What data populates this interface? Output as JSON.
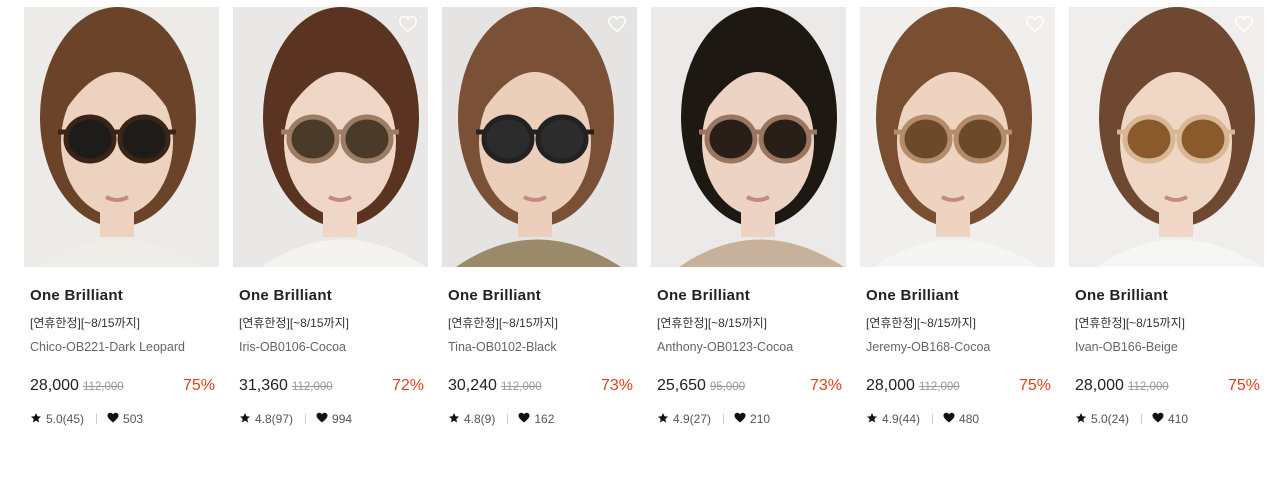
{
  "products": [
    {
      "brand": "One Brilliant",
      "promo": "[연휴한정][~8/15까지]",
      "name": "Chico-OB221-Dark Leopard",
      "price": "28,000",
      "original_price": "112,000",
      "discount": "75%",
      "rating": "5.0(45)",
      "likes": "503",
      "bg": "#ecebe8",
      "hair": "#6b4328",
      "skin": "#ecd2bf",
      "cloth": "#efede8",
      "frame": "#3a2417",
      "lens": "#1d1c1a",
      "wishlist_icon": false
    },
    {
      "brand": "One Brilliant",
      "promo": "[연휴한정][~8/15까지]",
      "name": "Iris-OB0106-Cocoa",
      "price": "31,360",
      "original_price": "112,000",
      "discount": "72%",
      "rating": "4.8(97)",
      "likes": "994",
      "bg": "#e9e8e6",
      "hair": "#5a3420",
      "skin": "#efd6c6",
      "cloth": "#f4f3f0",
      "frame": "#9c7c62",
      "lens": "#4a3a2a",
      "wishlist_icon": true
    },
    {
      "brand": "One Brilliant",
      "promo": "[연휴한정][~8/15까지]",
      "name": "Tina-OB0102-Black",
      "price": "30,240",
      "original_price": "112,000",
      "discount": "73%",
      "rating": "4.8(9)",
      "likes": "162",
      "bg": "#e6e4e2",
      "hair": "#7a5037",
      "skin": "#eccfbb",
      "cloth": "#9a8a6a",
      "frame": "#222222",
      "lens": "#2c2c2c",
      "wishlist_icon": true
    },
    {
      "brand": "One Brilliant",
      "promo": "[연휴한정][~8/15까지]",
      "name": "Anthony-OB0123-Cocoa",
      "price": "25,650",
      "original_price": "95,000",
      "discount": "73%",
      "rating": "4.9(27)",
      "likes": "210",
      "bg": "#ebeae8",
      "hair": "#1e1812",
      "skin": "#ecd3c3",
      "cloth": "#c7b19a",
      "frame": "#9a7660",
      "lens": "#2a1e18",
      "wishlist_icon": false
    },
    {
      "brand": "One Brilliant",
      "promo": "[연휴한정][~8/15까지]",
      "name": "Jeremy-OB168-Cocoa",
      "price": "28,000",
      "original_price": "112,000",
      "discount": "75%",
      "rating": "4.9(44)",
      "likes": "480",
      "bg": "#f0efed",
      "hair": "#7a4e30",
      "skin": "#efd3c1",
      "cloth": "#f5f5f3",
      "frame": "#b48c6c",
      "lens": "#6a4a2a",
      "wishlist_icon": true
    },
    {
      "brand": "One Brilliant",
      "promo": "[연휴한정][~8/15까지]",
      "name": "Ivan-OB166-Beige",
      "price": "28,000",
      "original_price": "112,000",
      "discount": "75%",
      "rating": "5.0(24)",
      "likes": "410",
      "bg": "#efeeec",
      "hair": "#6e4830",
      "skin": "#f0d6c4",
      "cloth": "#f6f6f4",
      "frame": "#d8b794",
      "lens": "#8a5a2c",
      "wishlist_icon": true
    }
  ],
  "colors": {
    "discount": "#e2411d",
    "brand_text": "#222222",
    "muted": "#666666"
  },
  "icons": {
    "rating": "star-icon",
    "likes": "heart-icon",
    "wishlist": "heart-outline-icon"
  }
}
